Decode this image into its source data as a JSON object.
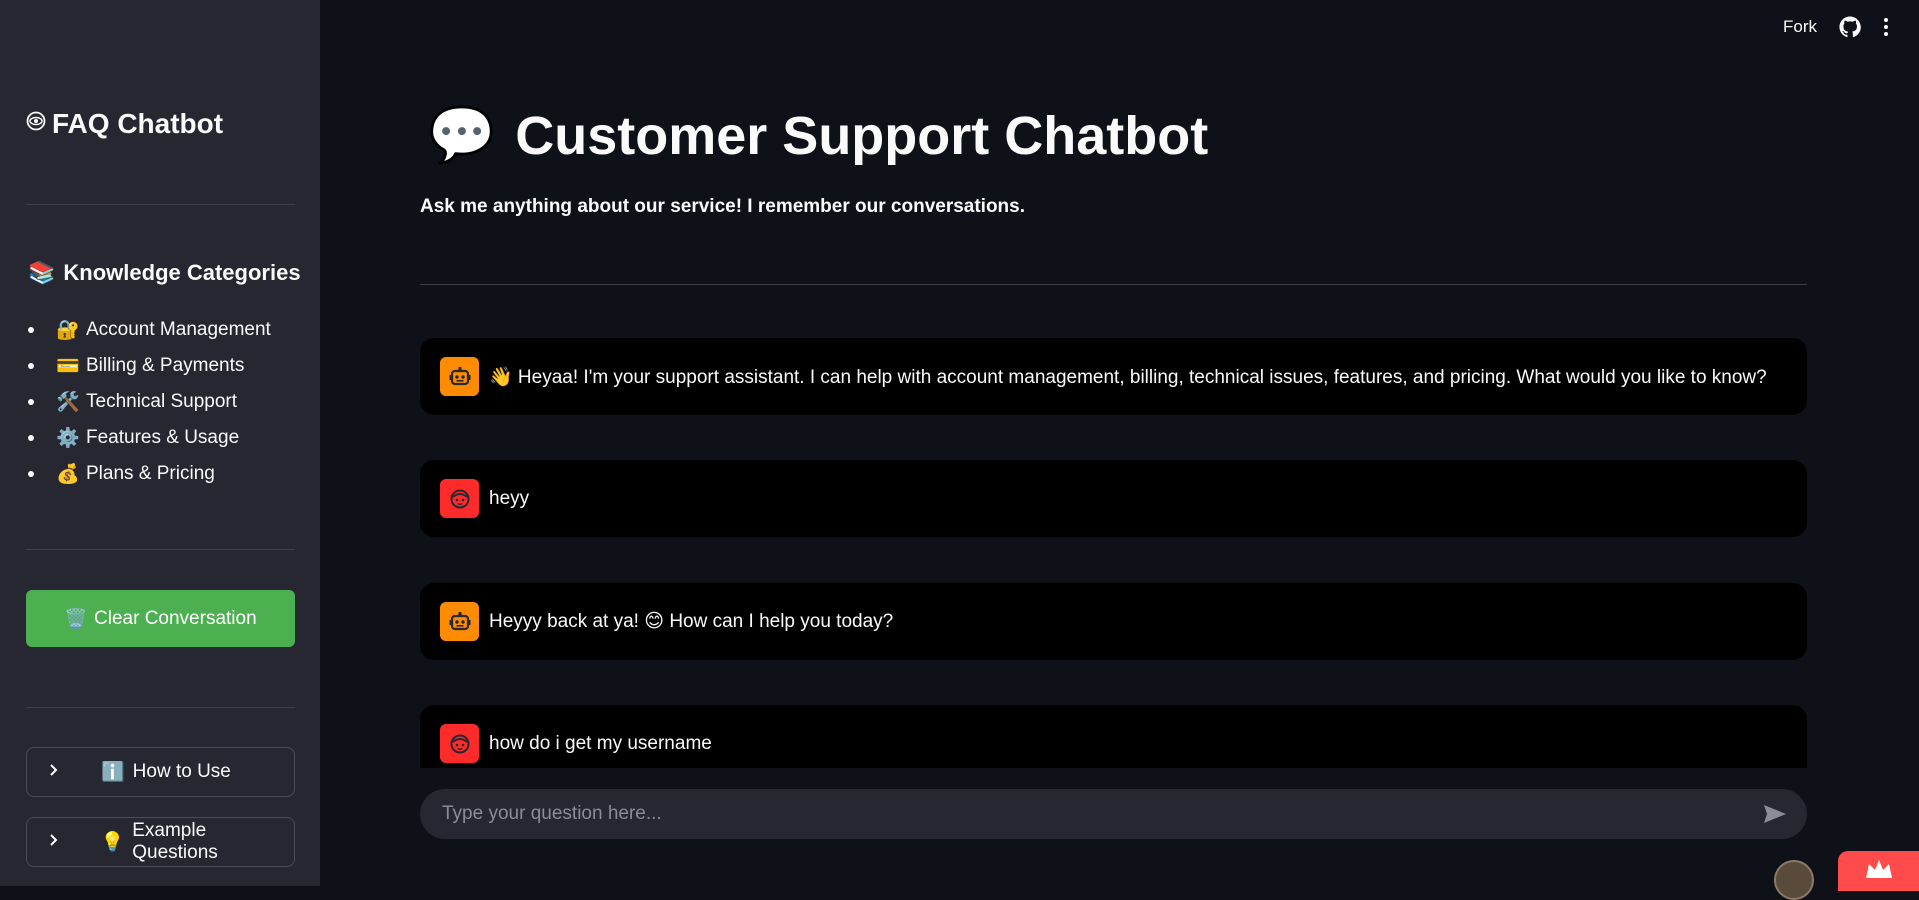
{
  "sidebar": {
    "title_icon": "eye-icon",
    "title": "FAQ Chatbot",
    "categories_heading_emoji": "📚",
    "categories_heading": "Knowledge Categories",
    "categories": [
      {
        "emoji": "🔐",
        "label": "Account Management"
      },
      {
        "emoji": "💳",
        "label": "Billing & Payments"
      },
      {
        "emoji": "🛠️",
        "label": "Technical Support"
      },
      {
        "emoji": "⚙️",
        "label": "Features & Usage"
      },
      {
        "emoji": "💰",
        "label": "Plans & Pricing"
      }
    ],
    "clear_button_emoji": "🗑️",
    "clear_button": "Clear Conversation",
    "expanders": [
      {
        "emoji": "ℹ️",
        "label": "How to Use"
      },
      {
        "emoji": "💡",
        "label": "Example Questions"
      }
    ]
  },
  "header": {
    "fork_label": "Fork",
    "github_icon": "github-icon",
    "menu_icon": "kebab-menu-icon"
  },
  "main": {
    "title_emoji": "💬",
    "title": "Customer Support Chatbot",
    "subtitle": "Ask me anything about our service! I remember our conversations."
  },
  "messages": [
    {
      "role": "assistant",
      "text": "👋 Heyaa! I'm your support assistant. I can help with account management, billing, technical issues, features, and pricing. What would you like to know?"
    },
    {
      "role": "user",
      "text": "heyy"
    },
    {
      "role": "assistant",
      "text": "Heyyy back at ya! 😊 How can I help you today?"
    },
    {
      "role": "user",
      "text": "how do i get my username"
    }
  ],
  "chat_input": {
    "placeholder": "Type your question here..."
  },
  "colors": {
    "bot_avatar": "#ff8c00",
    "user_avatar": "#ff2b2b",
    "clear_button": "#4caf50",
    "background": "#0e1117",
    "sidebar": "#262730"
  }
}
